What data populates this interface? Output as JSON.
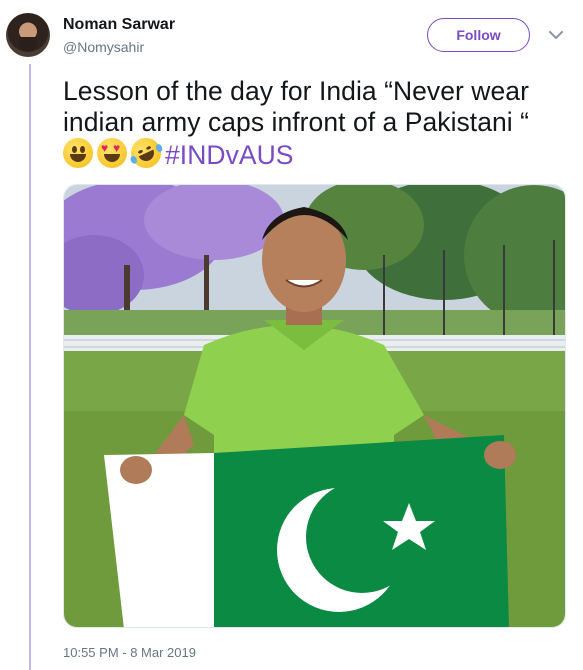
{
  "author": {
    "name": "Noman Sarwar",
    "handle": "@Nomysahir"
  },
  "follow_label": "Follow",
  "tweet": {
    "line1": "Lesson of the day for India “Never wear",
    "line2": "indian army caps infront of a Pakistani “",
    "emojis": [
      "smiley-emoji",
      "heart-eyes-emoji",
      "rofl-emoji"
    ],
    "hashtag": "#INDvAUS"
  },
  "media": {
    "description_icon": "photo",
    "colors": {
      "jersey": "#8fd14f",
      "flag_green": "#0b8a43",
      "flag_white": "#ffffff",
      "grass": "#6f9b3d",
      "jacaranda": "#9b7ad1"
    }
  },
  "timestamp": "10:55 PM - 8 Mar 2019",
  "colors": {
    "accent": "#794bc4",
    "thread_line": "#c8b6e2",
    "secondary_text": "#657786"
  }
}
